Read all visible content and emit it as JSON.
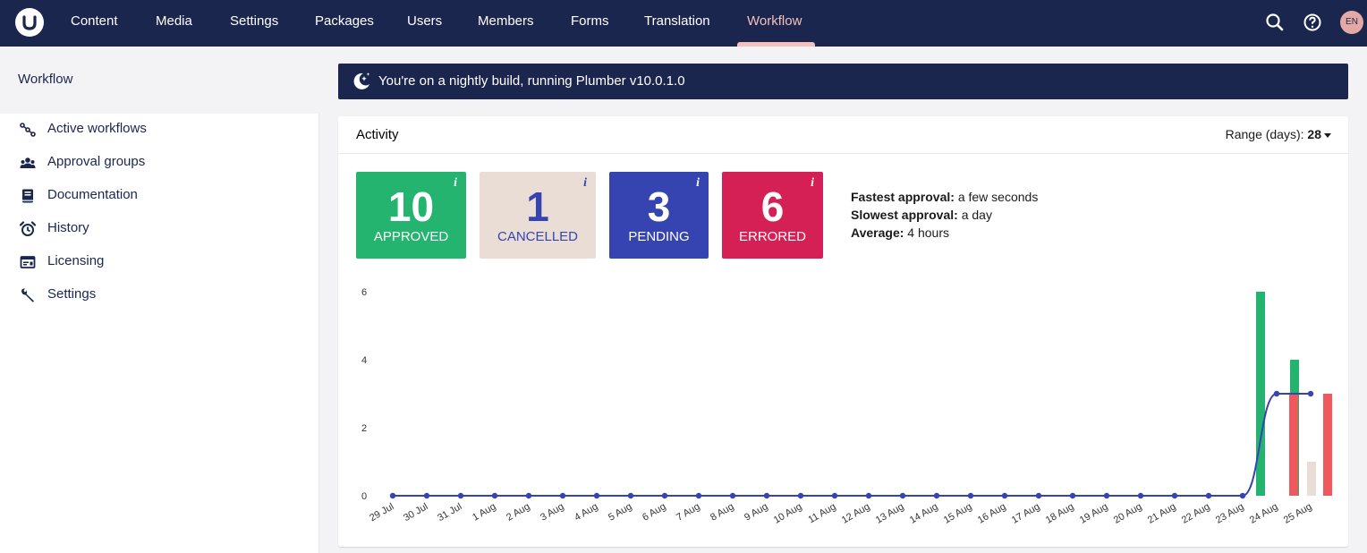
{
  "nav": {
    "items": [
      "Content",
      "Media",
      "Settings",
      "Packages",
      "Users",
      "Members",
      "Forms",
      "Translation",
      "Workflow"
    ],
    "active": "Workflow",
    "avatar": "EN"
  },
  "sidebar": {
    "title": "Workflow",
    "items": [
      {
        "label": "Active workflows",
        "icon": "nodes-icon"
      },
      {
        "label": "Approval groups",
        "icon": "users-icon"
      },
      {
        "label": "Documentation",
        "icon": "book-icon"
      },
      {
        "label": "History",
        "icon": "alarm-clock-icon"
      },
      {
        "label": "Licensing",
        "icon": "license-icon"
      },
      {
        "label": "Settings",
        "icon": "wrench-icon"
      }
    ]
  },
  "banner": {
    "text": "You're on a nightly build, running Plumber v10.0.1.0",
    "icon": "moon-stars-icon"
  },
  "activity": {
    "title": "Activity",
    "range_label": "Range (days):",
    "range_value": "28",
    "stats": [
      {
        "value": "10",
        "label": "APPROVED",
        "info": "i",
        "bg": "#24b46f",
        "fg": "#ffffff"
      },
      {
        "value": "1",
        "label": "CANCELLED",
        "info": "i",
        "bg": "#e9ddd6",
        "fg": "#3544b1"
      },
      {
        "value": "3",
        "label": "PENDING",
        "info": "i",
        "bg": "#3544b1",
        "fg": "#ffffff"
      },
      {
        "value": "6",
        "label": "ERRORED",
        "info": "i",
        "bg": "#d42054",
        "fg": "#ffffff"
      }
    ],
    "summary": [
      {
        "key": "Fastest approval:",
        "value": " a few seconds"
      },
      {
        "key": "Slowest approval:",
        "value": " a day"
      },
      {
        "key": "Average:",
        "value": " 4 hours"
      }
    ]
  },
  "chart_data": {
    "type": "bar",
    "categories": [
      "29 Jul",
      "30 Jul",
      "31 Jul",
      "1 Aug",
      "2 Aug",
      "3 Aug",
      "4 Aug",
      "5 Aug",
      "6 Aug",
      "7 Aug",
      "8 Aug",
      "9 Aug",
      "10 Aug",
      "11 Aug",
      "12 Aug",
      "13 Aug",
      "14 Aug",
      "15 Aug",
      "16 Aug",
      "17 Aug",
      "18 Aug",
      "19 Aug",
      "20 Aug",
      "21 Aug",
      "22 Aug",
      "23 Aug",
      "24 Aug",
      "25 Aug"
    ],
    "ylim": [
      0,
      6
    ],
    "yticks": [
      0,
      2,
      4,
      6
    ],
    "series": [
      {
        "type": "bar",
        "color": "#24b46f",
        "values": [
          0,
          0,
          0,
          0,
          0,
          0,
          0,
          0,
          0,
          0,
          0,
          0,
          0,
          0,
          0,
          0,
          0,
          0,
          0,
          0,
          0,
          0,
          0,
          0,
          0,
          0,
          6,
          4
        ]
      },
      {
        "type": "bar",
        "color": "#e9ddd6",
        "values": [
          0,
          0,
          0,
          0,
          0,
          0,
          0,
          0,
          0,
          0,
          0,
          0,
          0,
          0,
          0,
          0,
          0,
          0,
          0,
          0,
          0,
          0,
          0,
          0,
          0,
          0,
          0,
          1
        ]
      },
      {
        "type": "bar",
        "color": "#f0585e",
        "values": [
          0,
          0,
          0,
          0,
          0,
          0,
          0,
          0,
          0,
          0,
          0,
          0,
          0,
          0,
          0,
          0,
          0,
          0,
          0,
          0,
          0,
          0,
          0,
          0,
          0,
          0,
          3,
          3
        ]
      },
      {
        "type": "line",
        "color": "#3544b1",
        "values": [
          0,
          0,
          0,
          0,
          0,
          0,
          0,
          0,
          0,
          0,
          0,
          0,
          0,
          0,
          0,
          0,
          0,
          0,
          0,
          0,
          0,
          0,
          0,
          0,
          0,
          0,
          3,
          3
        ]
      }
    ]
  }
}
